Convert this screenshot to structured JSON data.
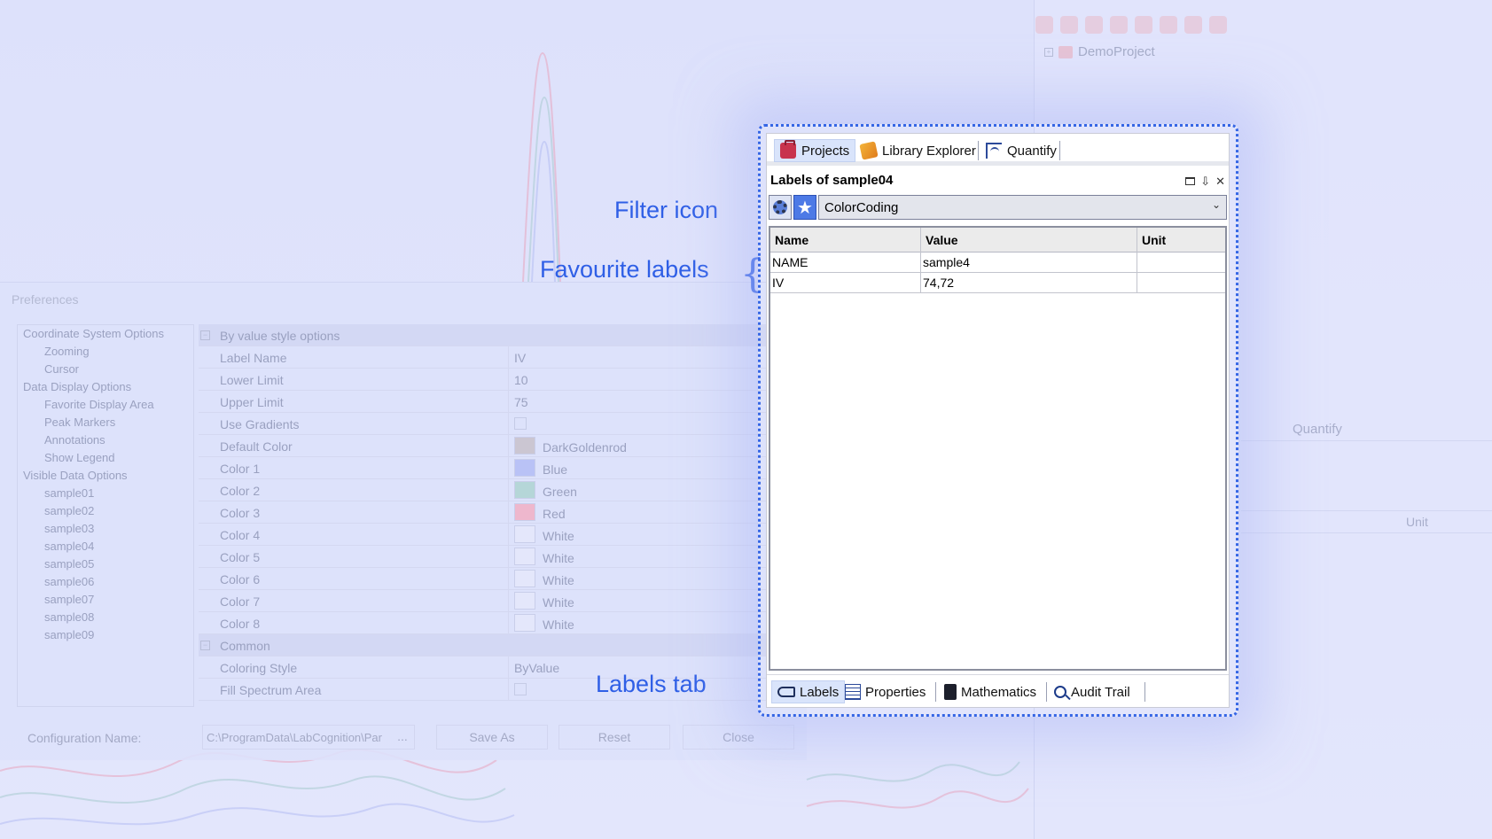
{
  "window": {
    "accent_color": "#2f5fe6"
  },
  "callouts": {
    "filter_icon": "Filter icon",
    "favourite_labels": "Favourite labels",
    "labels_tab": "Labels tab"
  },
  "projects_panel": {
    "tree_item": "DemoProject",
    "ghost_tab": "Quantify",
    "ghost_column": "Unit"
  },
  "preferences": {
    "title": "Preferences",
    "tree": [
      {
        "label": "Coordinate System Options",
        "level": 1
      },
      {
        "label": "Zooming",
        "level": 2
      },
      {
        "label": "Cursor",
        "level": 2
      },
      {
        "label": "Data Display Options",
        "level": 1
      },
      {
        "label": "Favorite Display Area",
        "level": 2
      },
      {
        "label": "Peak Markers",
        "level": 2
      },
      {
        "label": "Annotations",
        "level": 2
      },
      {
        "label": "Show Legend",
        "level": 2
      },
      {
        "label": "Visible Data Options",
        "level": 1
      },
      {
        "label": "sample01",
        "level": 2
      },
      {
        "label": "sample02",
        "level": 2
      },
      {
        "label": "sample03",
        "level": 2
      },
      {
        "label": "sample04",
        "level": 2
      },
      {
        "label": "sample05",
        "level": 2
      },
      {
        "label": "sample06",
        "level": 2
      },
      {
        "label": "sample07",
        "level": 2
      },
      {
        "label": "sample08",
        "level": 2
      },
      {
        "label": "sample09",
        "level": 2
      }
    ],
    "category_by_value": "By value style options",
    "category_common": "Common",
    "rows": {
      "label_name": {
        "key": "Label Name",
        "value": "IV"
      },
      "lower_limit": {
        "key": "Lower Limit",
        "value": "10"
      },
      "upper_limit": {
        "key": "Upper Limit",
        "value": "75"
      },
      "use_gradients": {
        "key": "Use Gradients"
      },
      "default_color": {
        "key": "Default Color",
        "value": "DarkGoldenrod",
        "swatch": "#cbc6d2"
      },
      "color1": {
        "key": "Color 1",
        "value": "Blue",
        "swatch": "#b9c2f6"
      },
      "color2": {
        "key": "Color 2",
        "value": "Green",
        "swatch": "#b5d6d8"
      },
      "color3": {
        "key": "Color 3",
        "value": "Red",
        "swatch": "#eeb7cd"
      },
      "color4": {
        "key": "Color 4",
        "value": "White",
        "swatch": "#e4e7fb"
      },
      "color5": {
        "key": "Color 5",
        "value": "White",
        "swatch": "#e4e7fb"
      },
      "color6": {
        "key": "Color 6",
        "value": "White",
        "swatch": "#e4e7fb"
      },
      "color7": {
        "key": "Color 7",
        "value": "White",
        "swatch": "#e4e7fb"
      },
      "color8": {
        "key": "Color 8",
        "value": "White",
        "swatch": "#e4e7fb"
      },
      "coloring_style": {
        "key": "Coloring Style",
        "value": "ByValue"
      },
      "fill_spectrum": {
        "key": "Fill Spectrum Area"
      }
    },
    "footer": {
      "config_label": "Configuration Name:",
      "config_path": "C:\\ProgramData\\LabCognition\\Par",
      "browse": "...",
      "save_as": "Save As",
      "reset": "Reset",
      "close": "Close"
    }
  },
  "labels_panel": {
    "top_tabs": [
      {
        "label": "Projects",
        "icon": "toolbox-icon",
        "active": true
      },
      {
        "label": "Library Explorer",
        "icon": "library-icon",
        "active": false
      },
      {
        "label": "Quantify",
        "icon": "quantify-icon",
        "active": false
      }
    ],
    "title": "Labels of sample04",
    "filter_select": "ColorCoding",
    "columns": [
      "Name",
      "Value",
      "Unit"
    ],
    "rows": [
      {
        "name": "NAME",
        "value": "sample4",
        "unit": ""
      },
      {
        "name": "IV",
        "value": "74,72",
        "unit": ""
      }
    ],
    "bottom_tabs": [
      {
        "label": "Labels",
        "icon": "labels-icon",
        "active": true
      },
      {
        "label": "Properties",
        "icon": "properties-icon",
        "active": false
      },
      {
        "label": "Mathematics",
        "icon": "calculator-icon",
        "active": false
      },
      {
        "label": "Audit Trail",
        "icon": "magnifier-icon",
        "active": false
      }
    ]
  }
}
